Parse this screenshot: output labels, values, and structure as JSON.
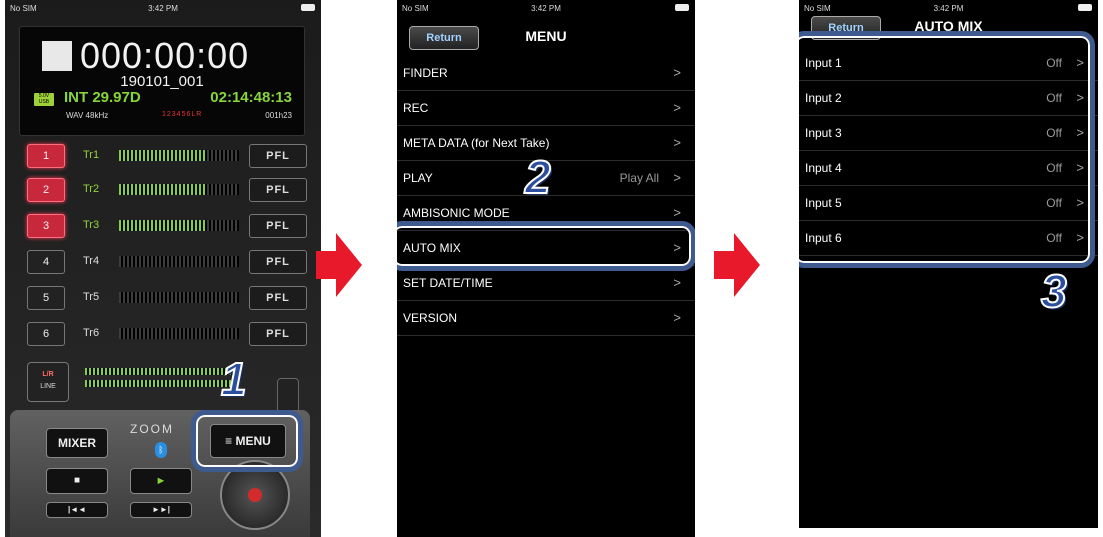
{
  "phone1": {
    "status": {
      "carrier": "No SIM",
      "time": "3:42 PM"
    },
    "timecode": "000:00:00",
    "filename": "190101_001",
    "usb_label": "5.0V USB",
    "frame_rate": "INT 29.97D",
    "tc_display": "02:14:48:13",
    "format": "WAV 48kHz",
    "tracks_indicator": "123456LR",
    "remaining": "001h23",
    "tracks": [
      {
        "num": "1",
        "name": "Tr1",
        "pfl": "PFL",
        "active": true,
        "level": 0.72
      },
      {
        "num": "2",
        "name": "Tr2",
        "pfl": "PFL",
        "active": true,
        "level": 0.72
      },
      {
        "num": "3",
        "name": "Tr3",
        "pfl": "PFL",
        "active": true,
        "level": 0.72
      },
      {
        "num": "4",
        "name": "Tr4",
        "pfl": "PFL",
        "active": false,
        "level": 0
      },
      {
        "num": "5",
        "name": "Tr5",
        "pfl": "PFL",
        "active": false,
        "level": 0
      },
      {
        "num": "6",
        "name": "Tr6",
        "pfl": "PFL",
        "active": false,
        "level": 0
      }
    ],
    "lr_button": {
      "top": "L/R",
      "bottom": "LINE"
    },
    "mixer_label": "MIXER",
    "menu_label": "≡ MENU",
    "logo": "ZOOM",
    "stop_symbol": "■",
    "play_symbol": "►",
    "rew_symbol": "|◄◄",
    "ff_symbol": "►►|",
    "step": "1"
  },
  "phone2": {
    "status": {
      "carrier": "No SIM",
      "time": "3:42 PM"
    },
    "return_label": "Return",
    "title": "MENU",
    "items": [
      {
        "label": "FINDER",
        "value": ""
      },
      {
        "label": "REC",
        "value": ""
      },
      {
        "label": "META DATA (for Next Take)",
        "value": ""
      },
      {
        "label": "PLAY",
        "value": "Play All"
      },
      {
        "label": "AMBISONIC MODE",
        "value": ""
      },
      {
        "label": "AUTO MIX",
        "value": ""
      },
      {
        "label": "SET DATE/TIME",
        "value": ""
      },
      {
        "label": "VERSION",
        "value": ""
      }
    ],
    "step": "2"
  },
  "phone3": {
    "status": {
      "carrier": "No SIM",
      "time": "3:42 PM"
    },
    "return_label": "Return",
    "title": "AUTO MIX",
    "items": [
      {
        "label": "Input 1",
        "value": "Off"
      },
      {
        "label": "Input 2",
        "value": "Off"
      },
      {
        "label": "Input 3",
        "value": "Off"
      },
      {
        "label": "Input 4",
        "value": "Off"
      },
      {
        "label": "Input 5",
        "value": "Off"
      },
      {
        "label": "Input 6",
        "value": "Off"
      }
    ],
    "step": "3"
  },
  "chevron": ">",
  "colors": {
    "highlight": "#3f5a8f",
    "arrow": "#e8192b",
    "step_number": "#2c4e9e"
  }
}
